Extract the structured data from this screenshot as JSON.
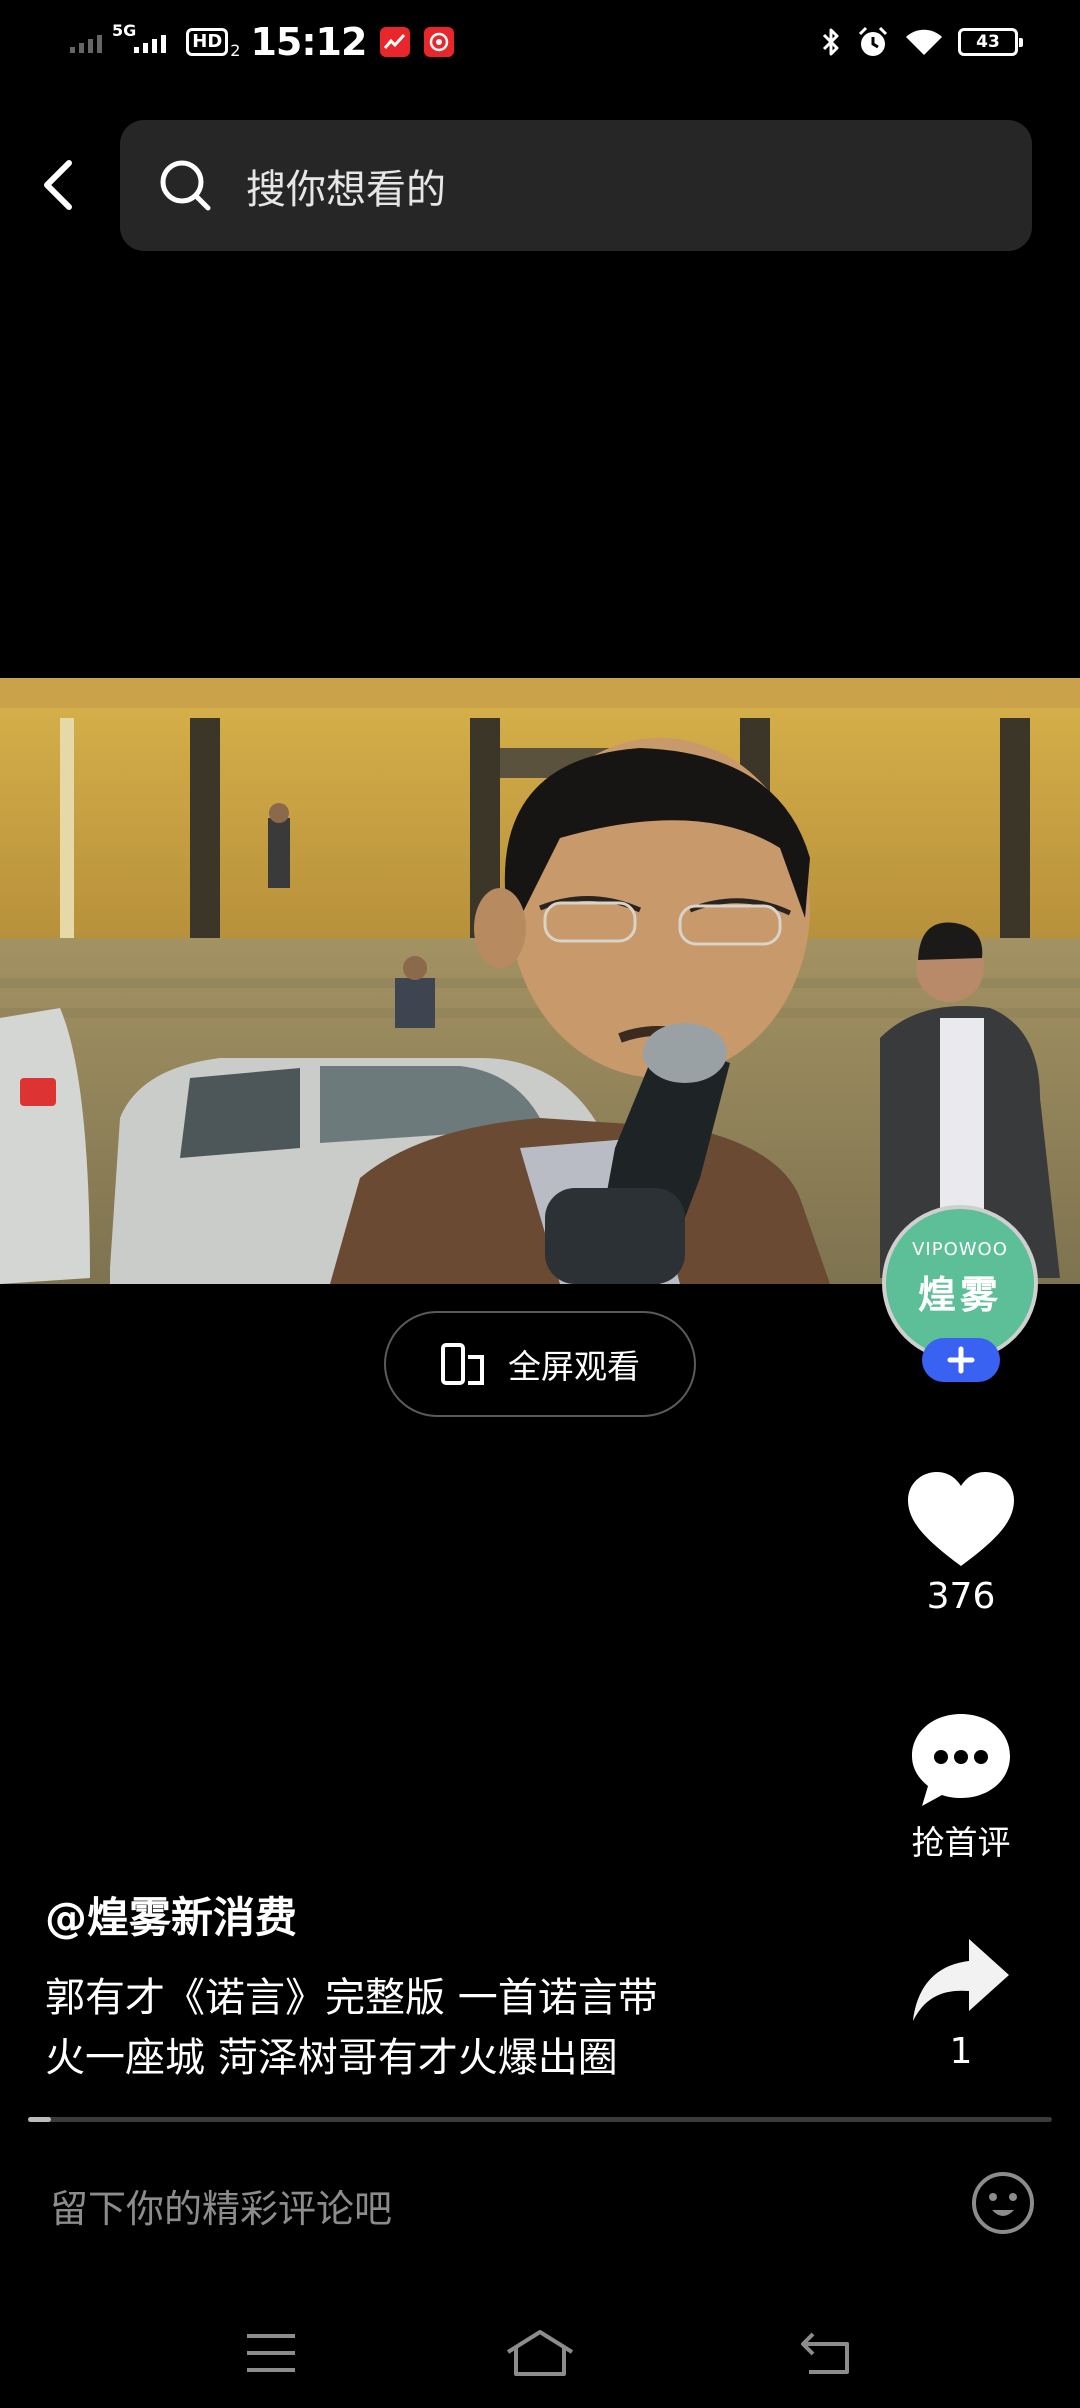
{
  "status_bar": {
    "network": "5G",
    "hd": "HD",
    "hd_sub": "2",
    "time": "15:12",
    "battery": "43"
  },
  "search": {
    "placeholder": "搜你想看的"
  },
  "player": {
    "fullscreen_label": "全屏观看",
    "progress": 0.022
  },
  "author_avatar": {
    "top_text": "VIPOWOO",
    "name_text": "煌雾"
  },
  "actions": {
    "likes": "376",
    "comment_label": "抢首评",
    "shares": "1"
  },
  "post": {
    "author": "@煌雾新消费",
    "caption_line1": "郭有才《诺言》完整版 一首诺言带",
    "caption_line2": "火一座城 菏泽树哥有才火爆出圈"
  },
  "comment_box": {
    "placeholder": "留下你的精彩评论吧"
  },
  "icons": {
    "back": "chevron-left-icon",
    "search": "search-icon",
    "fullscreen": "rotate-phone-icon",
    "like": "heart-icon",
    "comment": "speech-bubble-icon",
    "share": "share-arrow-icon",
    "emoji": "smiley-icon",
    "nav_menu": "menu-icon",
    "nav_home": "home-icon",
    "nav_back": "back-icon"
  },
  "colors": {
    "background": "#000000",
    "search_bg": "#262626",
    "follow_button": "#3a62f2",
    "avatar_bg": "#5cbf97"
  }
}
